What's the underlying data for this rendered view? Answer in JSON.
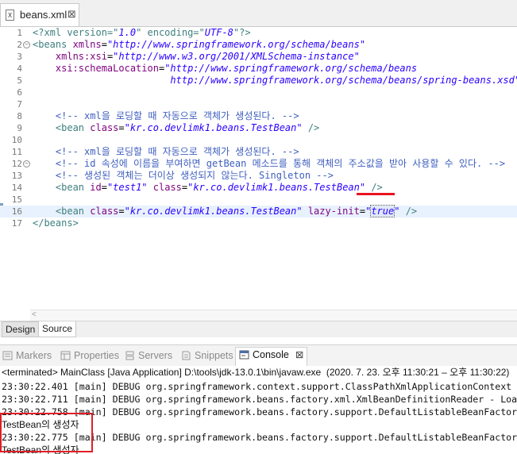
{
  "editor_tab": {
    "file_label": "X",
    "title": "beans.xml",
    "close": "⊠"
  },
  "code_lines": [
    {
      "num": "1",
      "fold": "",
      "parts": [
        {
          "c": "pi",
          "t": "<?xml version=\""
        },
        {
          "c": "val",
          "t": "1.0"
        },
        {
          "c": "pi",
          "t": "\" encoding=\""
        },
        {
          "c": "val",
          "t": "UTF-8"
        },
        {
          "c": "pi",
          "t": "\"?>"
        }
      ]
    },
    {
      "num": "2",
      "fold": "⊖",
      "parts": [
        {
          "c": "tag",
          "t": "<beans "
        },
        {
          "c": "attr",
          "t": "xmlns"
        },
        {
          "c": "",
          "t": "="
        },
        {
          "c": "val",
          "t": "\"http://www.springframework.org/schema/beans\""
        }
      ]
    },
    {
      "num": "3",
      "fold": "",
      "parts": [
        {
          "c": "",
          "t": "    "
        },
        {
          "c": "attr",
          "t": "xmlns:xsi"
        },
        {
          "c": "",
          "t": "="
        },
        {
          "c": "val",
          "t": "\"http://www.w3.org/2001/XMLSchema-instance\""
        }
      ]
    },
    {
      "num": "4",
      "fold": "",
      "parts": [
        {
          "c": "",
          "t": "    "
        },
        {
          "c": "attr",
          "t": "xsi:schemaLocation"
        },
        {
          "c": "",
          "t": "="
        },
        {
          "c": "val",
          "t": "\"http://www.springframework.org/schema/beans"
        }
      ]
    },
    {
      "num": "5",
      "fold": "",
      "parts": [
        {
          "c": "val",
          "t": "                        http://www.springframework.org/schema/beans/spring-beans.xsd\""
        },
        {
          "c": "tag",
          "t": ">"
        }
      ]
    },
    {
      "num": "6",
      "fold": "",
      "parts": []
    },
    {
      "num": "7",
      "fold": "",
      "parts": []
    },
    {
      "num": "8",
      "fold": "",
      "parts": [
        {
          "c": "",
          "t": "    "
        },
        {
          "c": "cmt",
          "t": "<!-- xml을 로딩할 때 자동으로 객체가 생성된다. -->"
        }
      ]
    },
    {
      "num": "9",
      "fold": "",
      "parts": [
        {
          "c": "",
          "t": "    "
        },
        {
          "c": "tag",
          "t": "<bean "
        },
        {
          "c": "attr",
          "t": "class"
        },
        {
          "c": "",
          "t": "="
        },
        {
          "c": "val",
          "t": "\"kr.co.devlimk1.beans.TestBean\""
        },
        {
          "c": "tag",
          "t": " />"
        }
      ]
    },
    {
      "num": "10",
      "fold": "",
      "parts": []
    },
    {
      "num": "11",
      "fold": "",
      "parts": [
        {
          "c": "",
          "t": "    "
        },
        {
          "c": "cmt",
          "t": "<!-- xml을 로딩할 때 자동으로 객체가 생성된다. -->"
        }
      ]
    },
    {
      "num": "12",
      "fold": "⊖",
      "parts": [
        {
          "c": "",
          "t": "    "
        },
        {
          "c": "cmt",
          "t": "<!-- id 속성에 이름을 부여하면 getBean 메소드를 통해 객체의 주소값을 받아 사용할 수 있다. -->"
        }
      ]
    },
    {
      "num": "13",
      "fold": "",
      "parts": [
        {
          "c": "",
          "t": "    "
        },
        {
          "c": "cmt",
          "t": "<!-- 생성된 객체는 더이상 생성되지 않는다. Singleton -->"
        }
      ]
    },
    {
      "num": "14",
      "fold": "",
      "parts": [
        {
          "c": "",
          "t": "    "
        },
        {
          "c": "tag",
          "t": "<bean "
        },
        {
          "c": "attr",
          "t": "id"
        },
        {
          "c": "",
          "t": "="
        },
        {
          "c": "val",
          "t": "\"test1\""
        },
        {
          "c": "",
          "t": " "
        },
        {
          "c": "attr",
          "t": "class"
        },
        {
          "c": "",
          "t": "="
        },
        {
          "c": "val",
          "t": "\"kr.co.devlimk1.beans.TestBean\""
        },
        {
          "c": "tag",
          "t": " />"
        }
      ]
    },
    {
      "num": "15",
      "fold": "",
      "parts": []
    },
    {
      "num": "16",
      "fold": "",
      "current": true,
      "parts": [
        {
          "c": "",
          "t": "    "
        },
        {
          "c": "tag",
          "t": "<bean "
        },
        {
          "c": "attr",
          "t": "class"
        },
        {
          "c": "",
          "t": "="
        },
        {
          "c": "val",
          "t": "\"kr.co.devlimk1.beans.TestBean\""
        },
        {
          "c": "",
          "t": " "
        },
        {
          "c": "attr",
          "t": "lazy-init"
        },
        {
          "c": "",
          "t": "="
        },
        {
          "c": "val",
          "t": "\""
        },
        {
          "c": "val sel",
          "t": "true"
        },
        {
          "c": "val",
          "t": "\""
        },
        {
          "c": "",
          "t": " "
        },
        {
          "c": "tag",
          "t": "/>"
        }
      ]
    },
    {
      "num": "17",
      "fold": "",
      "parts": [
        {
          "c": "tag",
          "t": "</beans>"
        }
      ]
    }
  ],
  "editor_bottom_tabs": {
    "design": "Design",
    "source": "Source"
  },
  "views": [
    {
      "label": "Markers",
      "icon": "markers-icon",
      "active": false
    },
    {
      "label": "Properties",
      "icon": "properties-icon",
      "active": false
    },
    {
      "label": "Servers",
      "icon": "servers-icon",
      "active": false
    },
    {
      "label": "Snippets",
      "icon": "snippets-icon",
      "active": false
    },
    {
      "label": "Console",
      "icon": "console-icon",
      "active": true,
      "close": "⊠"
    }
  ],
  "console": {
    "terminated_line": "<terminated> MainClass [Java Application] D:\\tools\\jdk-13.0.1\\bin\\javaw.exe  (2020. 7. 23. 오후 11:30:21 – 오후 11:30:22)",
    "lines": [
      "23:30:22.401 [main] DEBUG org.springframework.context.support.ClassPathXmlApplicationContext",
      "23:30:22.711 [main] DEBUG org.springframework.beans.factory.xml.XmlBeanDefinitionReader - Loaded",
      "23:30:22.758 [main] DEBUG org.springframework.beans.factory.support.DefaultListableBeanFactory",
      "TestBean의 생성자",
      "23:30:22.775 [main] DEBUG org.springframework.beans.factory.support.DefaultListableBeanFactory",
      "TestBean의 생성자"
    ]
  }
}
